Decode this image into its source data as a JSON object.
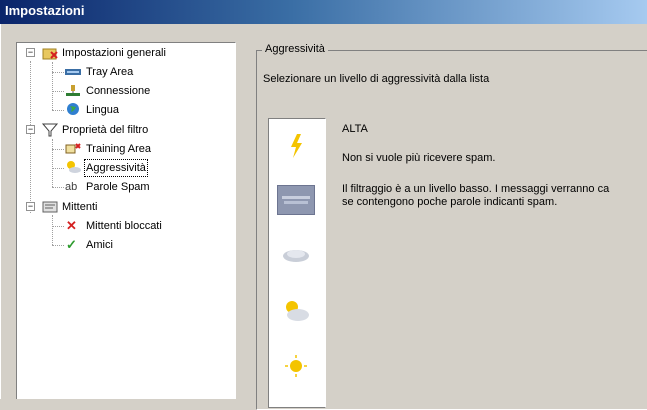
{
  "window": {
    "title": "Impostazioni"
  },
  "tree": {
    "general": {
      "label": "Impostazioni generali",
      "children": [
        {
          "label": "Tray Area",
          "icon": "tray-icon"
        },
        {
          "label": "Connessione",
          "icon": "network-icon"
        },
        {
          "label": "Lingua",
          "icon": "globe-icon"
        }
      ]
    },
    "filter": {
      "label": "Proprietà del filtro",
      "children": [
        {
          "label": "Training Area",
          "icon": "training-icon"
        },
        {
          "label": "Aggressività",
          "icon": "weather-icon"
        },
        {
          "label": "Parole Spam",
          "icon": "text-icon",
          "glyph": "ab"
        }
      ]
    },
    "senders": {
      "label": "Mittenti",
      "children": [
        {
          "label": "Mittenti bloccati",
          "icon": "red-x-icon",
          "glyph": "✕"
        },
        {
          "label": "Amici",
          "icon": "green-check-icon",
          "glyph": "✓"
        }
      ]
    },
    "expander_symbol": "−"
  },
  "panel": {
    "group_title": "Aggressività",
    "instruction": "Selezionare un livello di aggressività dalla lista",
    "levels": [
      {
        "icon": "lightning-icon",
        "glyph": "⚡"
      },
      {
        "icon": "fog-icon",
        "selected": true
      },
      {
        "icon": "cloud-icon"
      },
      {
        "icon": "sun-cloud-icon"
      },
      {
        "icon": "sun-icon"
      }
    ],
    "selected_level": {
      "title": "ALTA",
      "line1": "Non si vuole più ricevere spam.",
      "desc_line1": "Il filtraggio è a un livello basso. I messaggi verranno ca",
      "desc_line2": "se contengono poche parole indicanti spam."
    }
  },
  "colors": {
    "titlebar_start": "#0a246a",
    "titlebar_end": "#a6caf0",
    "face": "#d4d0c8",
    "selected_level_bg": "#8e97b0",
    "check_green": "#2e9b2e",
    "x_red": "#d42020"
  }
}
